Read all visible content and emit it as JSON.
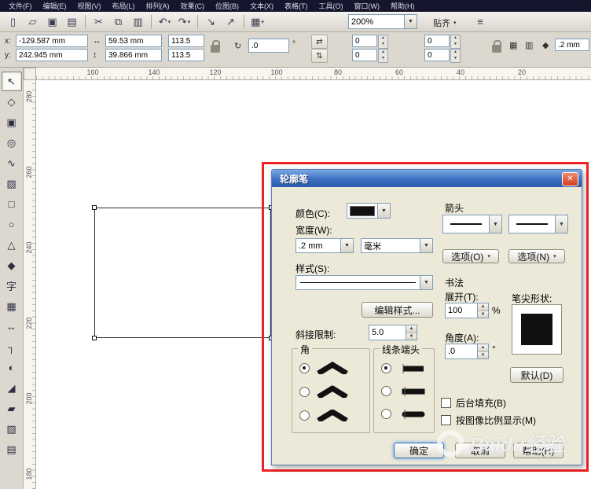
{
  "icons": {
    "dropdown": "▼",
    "dropdown_small": "▾",
    "spinner_up": "▲",
    "spinner_down": "▼",
    "close": "✕",
    "width_icon": "↔",
    "height_icon": "↕",
    "rotate_icon": "↻",
    "mirror_h": "⇄",
    "mirror_v": "⇅",
    "wrap_a": "▦",
    "wrap_b": "▥",
    "outline_pen": "◆",
    "options_icon": "≡"
  },
  "menubar": {
    "items": [
      "文件(F)",
      "编辑(E)",
      "视图(V)",
      "布局(L)",
      "排列(A)",
      "效果(C)",
      "位图(B)",
      "文本(X)",
      "表格(T)",
      "工具(O)",
      "窗口(W)",
      "帮助(H)"
    ]
  },
  "toolbar": {
    "icons": [
      {
        "name": "new-document-icon",
        "glyph": "▯"
      },
      {
        "name": "open-folder-icon",
        "glyph": "▱"
      },
      {
        "name": "save-icon",
        "glyph": "▣"
      },
      {
        "name": "print-icon",
        "glyph": "▤"
      },
      {
        "name": "separator"
      },
      {
        "name": "cut-icon",
        "glyph": "✂"
      },
      {
        "name": "copy-icon",
        "glyph": "⧉"
      },
      {
        "name": "paste-icon",
        "glyph": "▥"
      },
      {
        "name": "separator"
      },
      {
        "name": "undo-icon",
        "glyph": "↶",
        "dropdown": true
      },
      {
        "name": "redo-icon",
        "glyph": "↷",
        "dropdown": true
      },
      {
        "name": "separator"
      },
      {
        "name": "import-icon",
        "glyph": "↘"
      },
      {
        "name": "export-icon",
        "glyph": "↗"
      },
      {
        "name": "separator"
      },
      {
        "name": "app-launcher-icon",
        "glyph": "▦",
        "dropdown": true
      }
    ],
    "zoom_value": "200%",
    "snap_label": "贴齐"
  },
  "propbar": {
    "x_label": "x:",
    "y_label": "y:",
    "x_value": "-129.587 mm",
    "y_value": "242.945 mm",
    "width_value": "59.53 mm",
    "height_value": "39.866 mm",
    "scale_h": "113.5",
    "scale_v": "113.5",
    "rotation_value": ".0",
    "degree": "°",
    "corner_values": [
      "0",
      "0",
      "0",
      "0"
    ],
    "outline_width_value": ".2 mm"
  },
  "rulers": {
    "horizontal": [
      "160",
      "140",
      "120",
      "100",
      "80",
      "60",
      "40",
      "20"
    ],
    "vertical": [
      "280",
      "260",
      "240",
      "220",
      "200",
      "180"
    ]
  },
  "toolbox": {
    "tools": [
      {
        "name": "pick-tool",
        "glyph": "↖"
      },
      {
        "name": "shape-tool",
        "glyph": "◇"
      },
      {
        "name": "crop-tool",
        "glyph": "▣"
      },
      {
        "name": "zoom-tool",
        "glyph": "◎"
      },
      {
        "name": "freehand-tool",
        "glyph": "∿"
      },
      {
        "name": "smart-fill-tool",
        "glyph": "▧"
      },
      {
        "name": "rectangle-tool",
        "glyph": "□"
      },
      {
        "name": "ellipse-tool",
        "glyph": "○"
      },
      {
        "name": "polygon-tool",
        "glyph": "△"
      },
      {
        "name": "basic-shapes-tool",
        "glyph": "◆"
      },
      {
        "name": "text-tool",
        "glyph": "字"
      },
      {
        "name": "table-tool",
        "glyph": "▦"
      },
      {
        "name": "dimension-tool",
        "glyph": "↔"
      },
      {
        "name": "connector-tool",
        "glyph": "┐"
      },
      {
        "name": "blend-tool",
        "glyph": "◐"
      },
      {
        "name": "eyedropper-tool",
        "glyph": "◢"
      },
      {
        "name": "outline-pen-tool",
        "glyph": "▰"
      },
      {
        "name": "fill-tool",
        "glyph": "▨"
      },
      {
        "name": "interactive-fill-tool",
        "glyph": "▤"
      }
    ]
  },
  "dialog": {
    "title": "轮廓笔",
    "color_label": "颜色(C):",
    "width_label": "宽度(W):",
    "width_value": ".2 mm",
    "width_unit": "毫米",
    "style_label": "样式(S):",
    "edit_style_button": "编辑样式...",
    "miter_label": "斜接限制:",
    "miter_value": "5.0",
    "corners_label": "角",
    "caps_label": "线条端头",
    "arrows_label": "箭头",
    "options_o_button": "选项(O)",
    "options_n_button": "选项(N)",
    "calligraphy_label": "书法",
    "stretch_label": "展开(T):",
    "stretch_value": "100",
    "stretch_unit": "%",
    "nib_label": "笔尖形状:",
    "angle_label": "角度(A):",
    "angle_value": ".0",
    "angle_unit": "°",
    "default_button": "默认(D)",
    "behind_fill_checkbox": "后台填充(B)",
    "scale_image_checkbox": "按图像比例显示(M)",
    "ok_button": "确定",
    "cancel_button": "取消",
    "help_button": "帮助(H)"
  },
  "watermark": {
    "text": "Baidu经验"
  }
}
